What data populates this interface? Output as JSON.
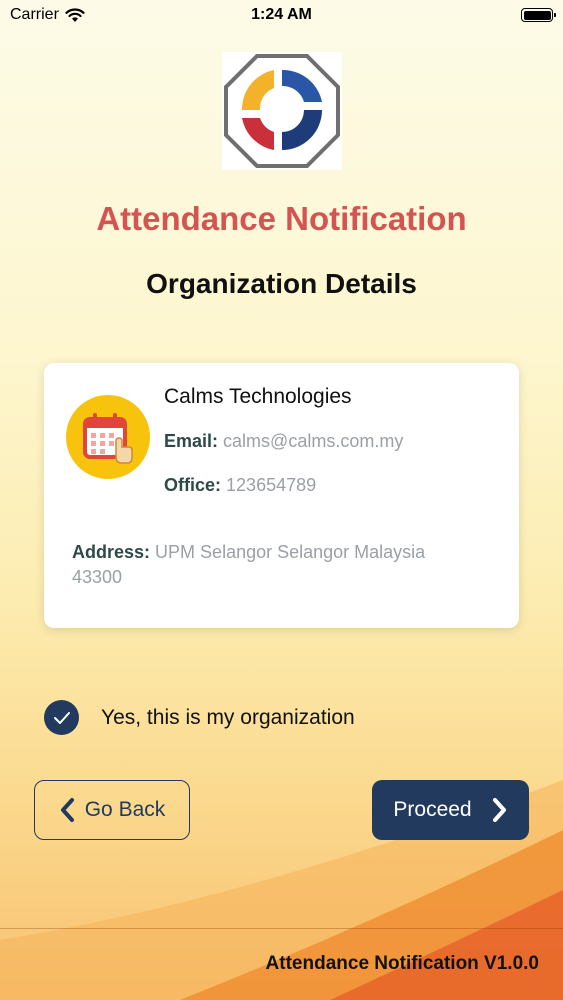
{
  "status_bar": {
    "carrier": "Carrier",
    "time": "1:24 AM"
  },
  "header": {
    "title": "Attendance Notification",
    "subtitle": "Organization Details"
  },
  "organization": {
    "name": "Calms Technologies",
    "email_label": "Email:",
    "email": "calms@calms.com.my",
    "office_label": "Office:",
    "office": "123654789",
    "address_label": "Address:",
    "address": "UPM Selangor Selangor Malaysia 43300"
  },
  "confirm": {
    "checked": true,
    "label": "Yes, this is my organization"
  },
  "buttons": {
    "back_label": "Go Back",
    "proceed_label": "Proceed"
  },
  "footer": {
    "version_text": "Attendance Notification V1.0.0"
  },
  "colors": {
    "title": "#d35450",
    "primary": "#223a5e",
    "accent_yellow": "#f7c30d",
    "label": "#2e4a48"
  },
  "icons": {
    "logo": "app-logo-icon",
    "organization": "calendar-icon",
    "check": "check-icon",
    "back": "chevron-left-icon",
    "proceed": "chevron-right-icon"
  }
}
